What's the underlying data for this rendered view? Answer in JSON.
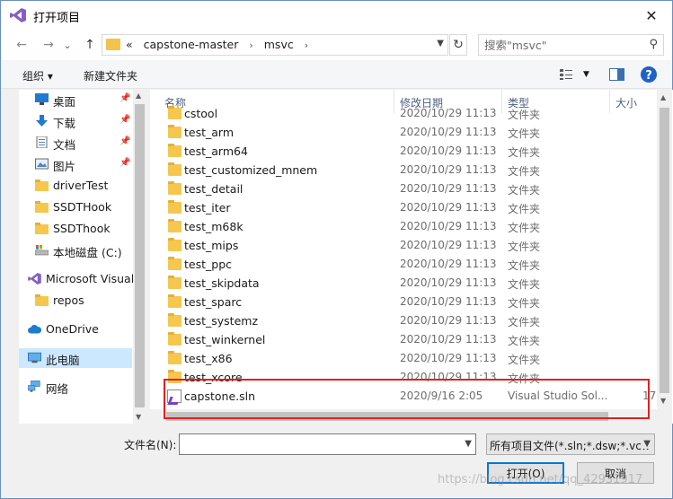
{
  "window": {
    "title": "打开项目",
    "close": "✕"
  },
  "nav": {
    "back": "←",
    "forward": "→",
    "dropdown": "⌄",
    "up": "↑",
    "crumbs_prefix": "«",
    "crumbs": [
      "capstone-master",
      "msvc"
    ],
    "crumb_sep": "›",
    "refresh": "↻",
    "search_placeholder": "搜索\"msvc\""
  },
  "toolbar": {
    "organize": "组织 ▾",
    "new_folder": "新建文件夹"
  },
  "sidebar": {
    "items": [
      {
        "label": "桌面",
        "pinned": true,
        "icon": "desktop-icon"
      },
      {
        "label": "下载",
        "pinned": true,
        "icon": "download-icon"
      },
      {
        "label": "文档",
        "pinned": true,
        "icon": "document-icon"
      },
      {
        "label": "图片",
        "pinned": true,
        "icon": "picture-icon"
      },
      {
        "label": "driverTest",
        "pinned": false,
        "icon": "folder-icon"
      },
      {
        "label": "SSDTHook",
        "pinned": false,
        "icon": "folder-icon"
      },
      {
        "label": "SSDThook",
        "pinned": false,
        "icon": "folder-icon"
      },
      {
        "label": "本地磁盘 (C:)",
        "pinned": false,
        "icon": "drive-icon"
      },
      {
        "label": "Microsoft Visual",
        "pinned": false,
        "icon": "visual-studio-icon"
      },
      {
        "label": "repos",
        "pinned": false,
        "icon": "folder-icon"
      },
      {
        "label": "OneDrive",
        "pinned": false,
        "icon": "cloud-icon"
      },
      {
        "label": "此电脑",
        "pinned": false,
        "icon": "computer-icon",
        "selected": true
      },
      {
        "label": "网络",
        "pinned": false,
        "icon": "network-icon"
      }
    ]
  },
  "columns": {
    "name": "名称",
    "date": "修改日期",
    "type": "类型",
    "size": "大小"
  },
  "files": [
    {
      "name": "cstool",
      "date": "2020/10/29 11:13",
      "type": "文件夹"
    },
    {
      "name": "test_arm",
      "date": "2020/10/29 11:13",
      "type": "文件夹"
    },
    {
      "name": "test_arm64",
      "date": "2020/10/29 11:13",
      "type": "文件夹"
    },
    {
      "name": "test_customized_mnem",
      "date": "2020/10/29 11:13",
      "type": "文件夹"
    },
    {
      "name": "test_detail",
      "date": "2020/10/29 11:13",
      "type": "文件夹"
    },
    {
      "name": "test_iter",
      "date": "2020/10/29 11:13",
      "type": "文件夹"
    },
    {
      "name": "test_m68k",
      "date": "2020/10/29 11:13",
      "type": "文件夹"
    },
    {
      "name": "test_mips",
      "date": "2020/10/29 11:13",
      "type": "文件夹"
    },
    {
      "name": "test_ppc",
      "date": "2020/10/29 11:13",
      "type": "文件夹"
    },
    {
      "name": "test_skipdata",
      "date": "2020/10/29 11:13",
      "type": "文件夹"
    },
    {
      "name": "test_sparc",
      "date": "2020/10/29 11:13",
      "type": "文件夹"
    },
    {
      "name": "test_systemz",
      "date": "2020/10/29 11:13",
      "type": "文件夹"
    },
    {
      "name": "test_winkernel",
      "date": "2020/10/29 11:13",
      "type": "文件夹"
    },
    {
      "name": "test_x86",
      "date": "2020/10/29 11:13",
      "type": "文件夹"
    },
    {
      "name": "test_xcore",
      "date": "2020/10/29 11:13",
      "type": "文件夹"
    }
  ],
  "sln_file": {
    "name": "capstone.sln",
    "date": "2020/9/16 2:05",
    "type": "Visual Studio Sol...",
    "size": "17"
  },
  "bottom": {
    "filename_label": "文件名(N):",
    "filename_value": "",
    "filter": "所有项目文件(*.sln;*.dsw;*.vcw",
    "open": "打开(O)",
    "cancel": "取消"
  },
  "watermark": "https://blog.csdn.net/qq_42931917",
  "colors": {
    "accent": "#0078d7",
    "selected": "#cce8ff",
    "folder": "#f5c74f",
    "highlight_box": "#e51e1e",
    "vs_purple": "#7b3ec4"
  }
}
